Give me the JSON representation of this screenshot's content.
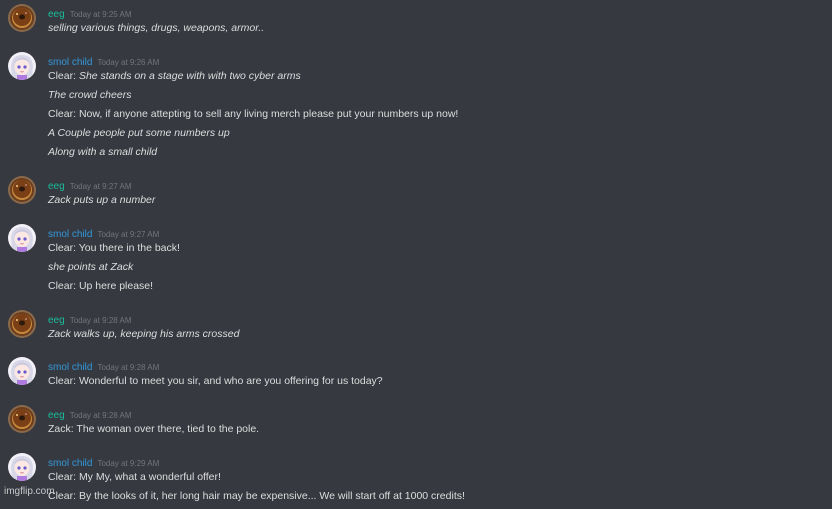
{
  "colors": {
    "background": "#36393f",
    "message_text": "#dcddde",
    "timestamp": "#72767d",
    "eeg_name": "#1abc9c",
    "smol_child_name": "#3498db"
  },
  "users": {
    "eeg": {
      "name": "eeg",
      "avatar": "donut-avatar-icon"
    },
    "smol_child": {
      "name": "smol child",
      "avatar": "anime-girl-avatar-icon"
    }
  },
  "groups": [
    {
      "user": "eeg",
      "name": "eeg",
      "timestamp": "Today at 9:25 AM",
      "messages": [
        {
          "text": "selling various things, drugs, weapons, armor..",
          "italic": true
        }
      ]
    },
    {
      "user": "smol_child",
      "name": "smol child",
      "timestamp": "Today at 9:26 AM",
      "messages": [
        {
          "prefix": "Clear: ",
          "text": "She stands on a stage with with two cyber arms",
          "italic": true
        },
        {
          "text": "The crowd cheers",
          "italic": true
        },
        {
          "prefix": "Clear: ",
          "text": "Now, if anyone attepting to sell any living merch please put your numbers up now!",
          "italic": false
        },
        {
          "text": "A Couple people put some numbers up",
          "italic": true
        },
        {
          "text": "Along with a small child",
          "italic": true
        }
      ]
    },
    {
      "user": "eeg",
      "name": "eeg",
      "timestamp": "Today at 9:27 AM",
      "messages": [
        {
          "text": "Zack puts up a number",
          "italic": true
        }
      ]
    },
    {
      "user": "smol_child",
      "name": "smol child",
      "timestamp": "Today at 9:27 AM",
      "messages": [
        {
          "prefix": "Clear: ",
          "text": "You there in the back!",
          "italic": false
        },
        {
          "text": "she points at Zack",
          "italic": true
        },
        {
          "prefix": "Clear: ",
          "text": "Up here please!",
          "italic": false
        }
      ]
    },
    {
      "user": "eeg",
      "name": "eeg",
      "timestamp": "Today at 9:28 AM",
      "messages": [
        {
          "text": "Zack walks up, keeping his arms crossed",
          "italic": true
        }
      ]
    },
    {
      "user": "smol_child",
      "name": "smol child",
      "timestamp": "Today at 9:28 AM",
      "messages": [
        {
          "prefix": "Clear: ",
          "text": "Wonderful to meet you sir, and who are you offering for us today?",
          "italic": false
        }
      ]
    },
    {
      "user": "eeg",
      "name": "eeg",
      "timestamp": "Today at 9:28 AM",
      "messages": [
        {
          "prefix": "Zack: ",
          "text": "The woman over there, tied to the pole.",
          "italic": false
        }
      ]
    },
    {
      "user": "smol_child",
      "name": "smol child",
      "timestamp": "Today at 9:29 AM",
      "messages": [
        {
          "prefix": "Clear: ",
          "text": "My My, what a wonderful offer!",
          "italic": false
        },
        {
          "prefix": "Clear: ",
          "text": "By the looks of it, her long hair may be expensive... We will start off at 1000 credits!",
          "italic": false
        }
      ]
    }
  ],
  "watermark": "imgflip.com"
}
